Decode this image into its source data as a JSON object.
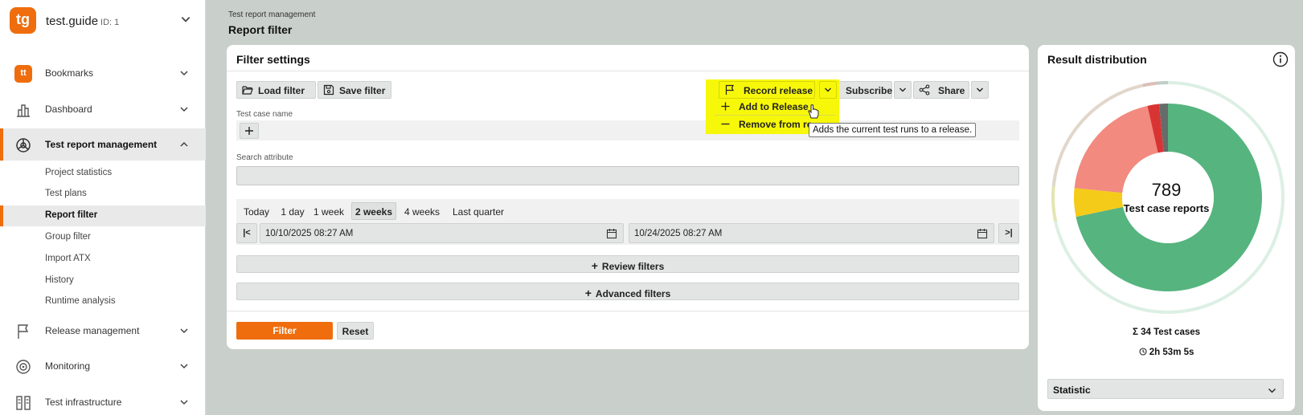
{
  "app": {
    "name": "test.guide",
    "id_label": "ID: 1",
    "logo_text": "tg"
  },
  "sidebar": {
    "items": [
      {
        "label": "Bookmarks",
        "icon": "bookmark-tt-icon",
        "badge": "tt"
      },
      {
        "label": "Dashboard",
        "icon": "bar-chart-icon"
      },
      {
        "label": "Test report management",
        "icon": "pie-chart-icon",
        "expanded": true
      },
      {
        "label": "Release management",
        "icon": "flag-icon"
      },
      {
        "label": "Monitoring",
        "icon": "target-icon"
      },
      {
        "label": "Test infrastructure",
        "icon": "rack-icon"
      }
    ],
    "subitems": [
      {
        "label": "Project statistics"
      },
      {
        "label": "Test plans"
      },
      {
        "label": "Report filter",
        "active": true
      },
      {
        "label": "Group filter"
      },
      {
        "label": "Import ATX"
      },
      {
        "label": "History"
      },
      {
        "label": "Runtime analysis"
      }
    ]
  },
  "header": {
    "breadcrumb": "Test report management",
    "title": "Report filter"
  },
  "filter": {
    "title": "Filter settings",
    "load_label": "Load filter",
    "save_label": "Save filter",
    "record_release_label": "Record release",
    "subscribe_label": "Subscribe",
    "share_label": "Share",
    "menu": {
      "add_label": "Add to Release",
      "remove_label": "Remove from re"
    },
    "tooltip": "Adds the current test runs to a release.",
    "test_case_name_label": "Test case name",
    "search_attribute_label": "Search attribute",
    "ranges": [
      "Today",
      "1 day",
      "1 week",
      "2 weeks",
      "4 weeks",
      "Last quarter"
    ],
    "selected_range": "2 weeks",
    "date_prev": "|<",
    "date_next": ">|",
    "date_from": "10/10/2025 08:27 AM",
    "date_to": "10/24/2025 08:27 AM",
    "review_filters_label": "Review filters",
    "advanced_filters_label": "Advanced filters",
    "filter_label": "Filter",
    "reset_label": "Reset"
  },
  "result": {
    "title": "Result distribution",
    "total": "789",
    "total_label": "Test case reports",
    "test_cases": "34 Test cases",
    "sigma": "Σ",
    "duration": "2h 53m 5s",
    "select_value": "Statistic"
  },
  "colors": {
    "accent": "#ef6d0d",
    "highlight": "#f7f70a",
    "passed": "#56b47f",
    "failed": "#f28a7f",
    "error": "#d93434",
    "inconclusive": "#f5cb19",
    "none": "#666c6a"
  },
  "chart_data": {
    "type": "pie",
    "donut": true,
    "slices": [
      {
        "color": "#56b47f",
        "fraction": 0.717
      },
      {
        "color": "#f5cb19",
        "fraction": 0.049
      },
      {
        "color": "#f28a7f",
        "fraction": 0.199
      },
      {
        "color": "#d93434",
        "fraction": 0.02
      },
      {
        "color": "#666c6a",
        "fraction": 0.015
      }
    ]
  }
}
